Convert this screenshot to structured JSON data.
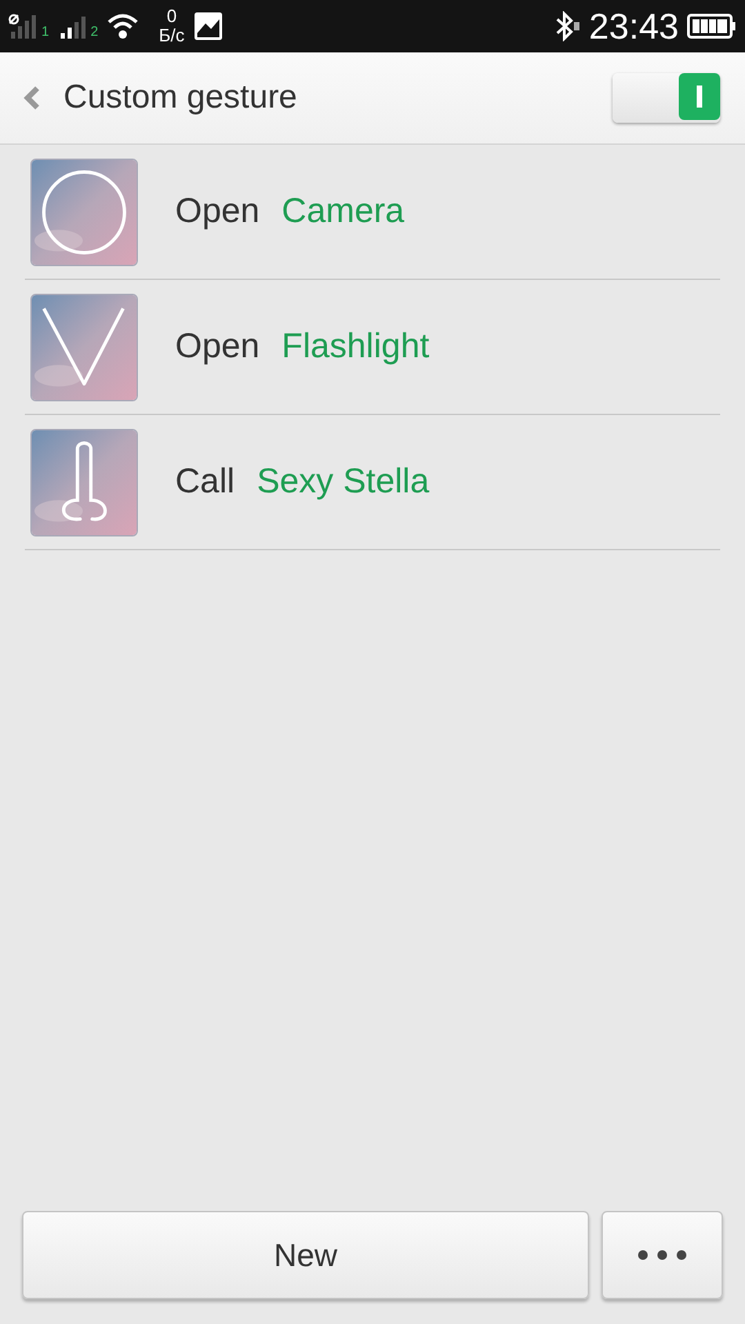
{
  "status_bar": {
    "sim1": "1",
    "sim2": "2",
    "speed_value": "0",
    "speed_unit": "Б/с",
    "time": "23:43"
  },
  "header": {
    "title": "Custom gesture",
    "toggle": {
      "on": true
    }
  },
  "gestures": [
    {
      "kind": "circle",
      "verb": "Open",
      "target": "Camera"
    },
    {
      "kind": "vee",
      "verb": "Open",
      "target": "Flashlight"
    },
    {
      "kind": "loop",
      "verb": "Call",
      "target": "Sexy Stella"
    }
  ],
  "buttons": {
    "new": "New"
  }
}
